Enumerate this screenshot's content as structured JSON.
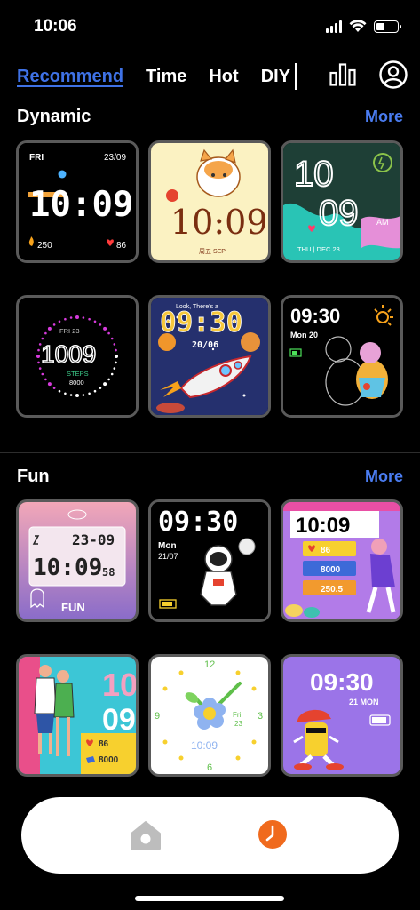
{
  "status_bar": {
    "time": "10:06"
  },
  "tabs": [
    {
      "label": "Recommend",
      "active": true
    },
    {
      "label": "Time",
      "active": false
    },
    {
      "label": "Hot",
      "active": false
    },
    {
      "label": "DIY",
      "active": false
    }
  ],
  "sections": {
    "dynamic": {
      "title": "Dynamic",
      "more": "More"
    },
    "fun": {
      "title": "Fun",
      "more": "More"
    }
  },
  "faces": {
    "f1": {
      "day": "FRI",
      "date": "23/09",
      "time": "10:09",
      "steps": "250",
      "heart": "86"
    },
    "f2": {
      "time": "10:09",
      "label": "周五 SEP"
    },
    "f3": {
      "hour": "10",
      "minute": "09",
      "ampm": "AM",
      "date": "THU | DEC 23"
    },
    "f4": {
      "date": "FRI   23",
      "time": "1009",
      "steps_label": "STEPS",
      "steps": "8000"
    },
    "f5": {
      "caption": "Look, There's a",
      "time": "09:30",
      "date": "20/06"
    },
    "f6": {
      "time": "09:30",
      "date": "Mon 20"
    },
    "f7": {
      "date": "23-09",
      "time": "10:09",
      "seconds": "58",
      "label": "FUN"
    },
    "f8": {
      "time": "09:30",
      "day": "Mon",
      "date": "21/07"
    },
    "f9": {
      "time": "10:09",
      "heart": "86",
      "steps": "8000",
      "cal": "250.5"
    },
    "f10": {
      "hour": "10",
      "minute": "09",
      "heart": "86",
      "steps": "8000"
    },
    "f11": {
      "time": "10:09",
      "day": "Fri",
      "date": "23",
      "n12": "12",
      "n3": "3",
      "n6": "6",
      "n9": "9"
    },
    "f12": {
      "time": "09:30",
      "date": "21 MON"
    }
  },
  "colors": {
    "accent": "#3f72e6",
    "more": "#4a7cf0",
    "clock_nav": "#f06a1d",
    "home_nav": "#bdbdbd"
  }
}
